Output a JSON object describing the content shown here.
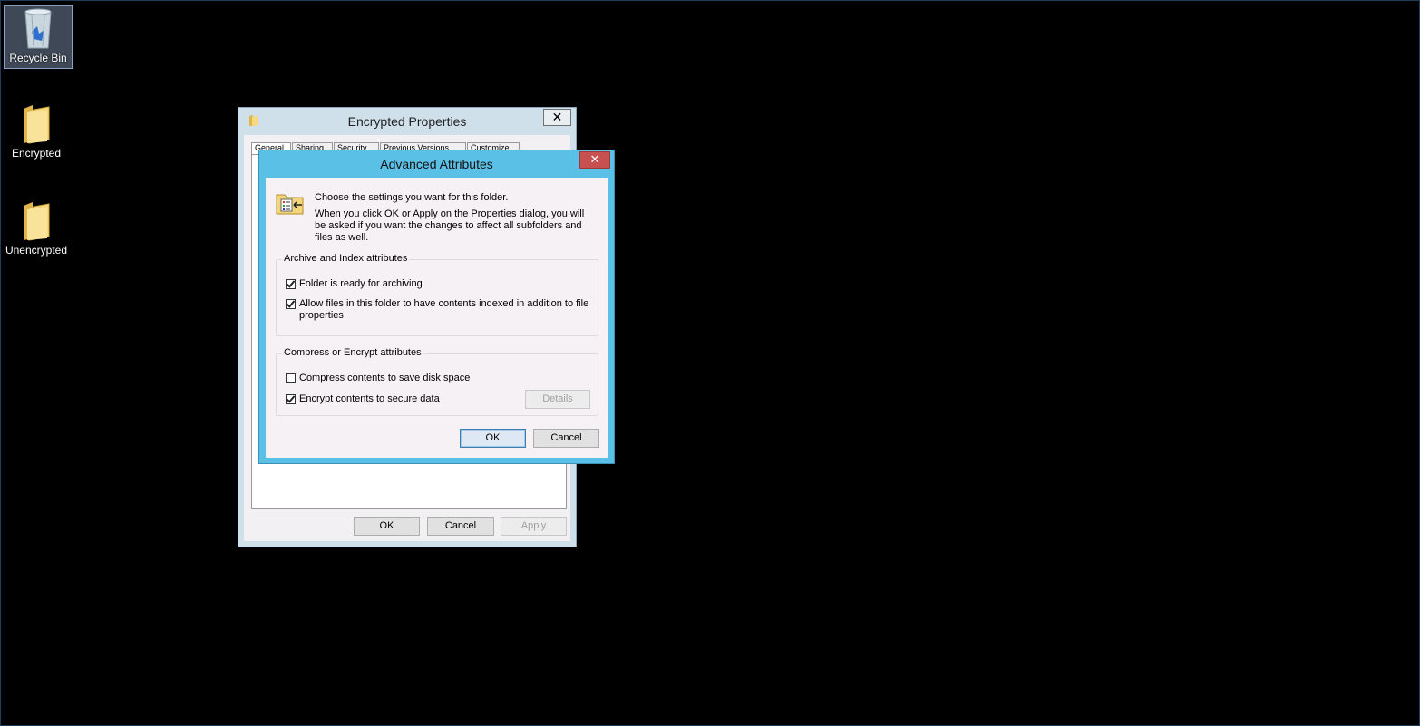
{
  "desktop": {
    "icons": [
      {
        "label": "Recycle Bin"
      },
      {
        "label": "Encrypted"
      },
      {
        "label": "Unencrypted"
      }
    ]
  },
  "properties_window": {
    "title": "Encrypted Properties",
    "close_glyph": "✕",
    "tabs": [
      "General",
      "Sharing",
      "Security",
      "Previous Versions",
      "Customize"
    ],
    "ok_label": "OK",
    "cancel_label": "Cancel",
    "apply_label": "Apply"
  },
  "advanced_dialog": {
    "title": "Advanced Attributes",
    "close_glyph": "✕",
    "intro": "Choose the settings you want for this folder.",
    "description": "When you click OK or Apply on the Properties dialog, you will be asked if you want the changes to affect all subfolders and files as well.",
    "archive_group": {
      "legend": "Archive and Index attributes",
      "ready_for_archiving": {
        "label": "Folder is ready for archiving",
        "checked": true
      },
      "allow_indexing": {
        "label": "Allow files in this folder to have contents indexed in addition to file properties",
        "checked": true
      }
    },
    "compress_group": {
      "legend": "Compress or Encrypt attributes",
      "compress": {
        "label": "Compress contents to save disk space",
        "checked": false
      },
      "encrypt": {
        "label": "Encrypt contents to secure data",
        "checked": true
      },
      "details_label": "Details"
    },
    "ok_label": "OK",
    "cancel_label": "Cancel"
  },
  "colors": {
    "desktop_bg": "#000000",
    "dialog_frame": "#5bc0e6",
    "close_button": "#c75050",
    "properties_frame": "#cfe0ea"
  }
}
